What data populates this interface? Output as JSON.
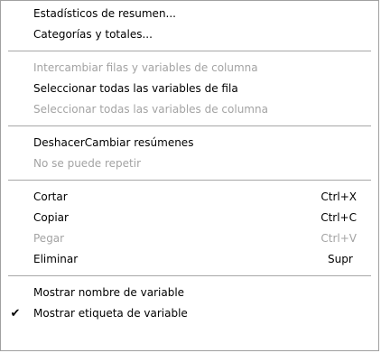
{
  "menu": {
    "groups": [
      {
        "items": [
          {
            "label": "Estadísticos de resumen...",
            "enabled": true
          },
          {
            "label": "Categorías y totales...",
            "enabled": true
          }
        ]
      },
      {
        "items": [
          {
            "label": "Intercambiar filas y variables de columna",
            "enabled": false
          },
          {
            "label": "Seleccionar todas las variables de fila",
            "enabled": true
          },
          {
            "label": "Seleccionar todas las variables de columna",
            "enabled": false
          }
        ]
      },
      {
        "items": [
          {
            "label": "DeshacerCambiar resúmenes",
            "enabled": true
          },
          {
            "label": "No se puede repetir",
            "enabled": false
          }
        ]
      },
      {
        "items": [
          {
            "label": "Cortar",
            "shortcut": "Ctrl+X",
            "enabled": true
          },
          {
            "label": "Copiar",
            "shortcut": "Ctrl+C",
            "enabled": true
          },
          {
            "label": "Pegar",
            "shortcut": "Ctrl+V",
            "enabled": false
          },
          {
            "label": "Eliminar",
            "shortcut": "Supr",
            "enabled": true
          }
        ]
      },
      {
        "items": [
          {
            "label": "Mostrar nombre de variable",
            "enabled": true,
            "checked": false
          },
          {
            "label": "Mostrar etiqueta de variable",
            "enabled": true,
            "checked": true,
            "check_glyph": "✔"
          }
        ]
      }
    ]
  }
}
